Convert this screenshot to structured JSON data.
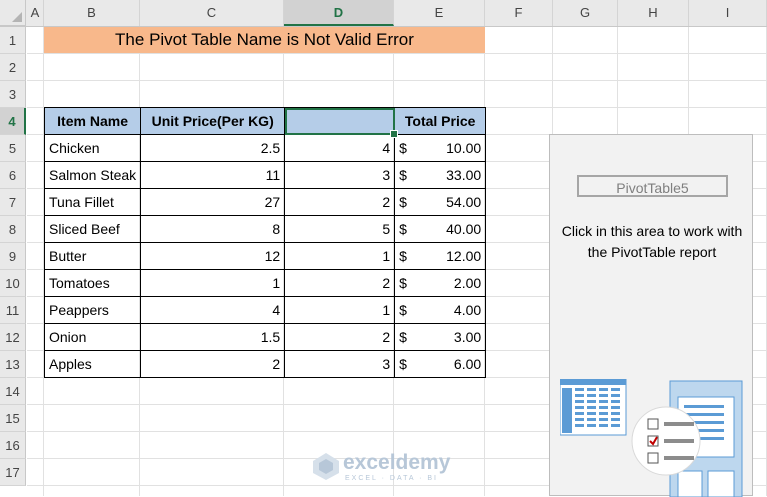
{
  "columns": [
    "A",
    "B",
    "C",
    "D",
    "E",
    "F",
    "G",
    "H",
    "I"
  ],
  "rows": [
    "1",
    "2",
    "3",
    "4",
    "5",
    "6",
    "7",
    "8",
    "9",
    "10",
    "11",
    "12",
    "13",
    "14",
    "15",
    "16",
    "17"
  ],
  "title": "The Pivot Table Name is Not Valid Error",
  "table": {
    "headers": [
      "Item Name",
      "Unit Price(Per KG)",
      "",
      "Total Price"
    ],
    "rows": [
      {
        "item": "Chicken",
        "price": "2.5",
        "qty": "4",
        "currency": "$",
        "total": "10.00"
      },
      {
        "item": "Salmon Steak",
        "price": "11",
        "qty": "3",
        "currency": "$",
        "total": "33.00"
      },
      {
        "item": "Tuna Fillet",
        "price": "27",
        "qty": "2",
        "currency": "$",
        "total": "54.00"
      },
      {
        "item": "Sliced Beef",
        "price": "8",
        "qty": "5",
        "currency": "$",
        "total": "40.00"
      },
      {
        "item": "Butter",
        "price": "12",
        "qty": "1",
        "currency": "$",
        "total": "12.00"
      },
      {
        "item": "Tomatoes",
        "price": "1",
        "qty": "2",
        "currency": "$",
        "total": "2.00"
      },
      {
        "item": "Peappers",
        "price": "4",
        "qty": "1",
        "currency": "$",
        "total": "4.00"
      },
      {
        "item": "Onion",
        "price": "1.5",
        "qty": "2",
        "currency": "$",
        "total": "3.00"
      },
      {
        "item": "Apples",
        "price": "2",
        "qty": "3",
        "currency": "$",
        "total": "6.00"
      }
    ]
  },
  "pivot": {
    "name": "PivotTable5",
    "message_line1": "Click in this area to work with",
    "message_line2": "the PivotTable report"
  },
  "watermark": {
    "brand": "exceldemy",
    "tagline": "EXCEL · DATA · BI"
  },
  "colors": {
    "title_bg": "#f8b88b",
    "header_bg": "#b5cde8",
    "selection": "#217346"
  }
}
